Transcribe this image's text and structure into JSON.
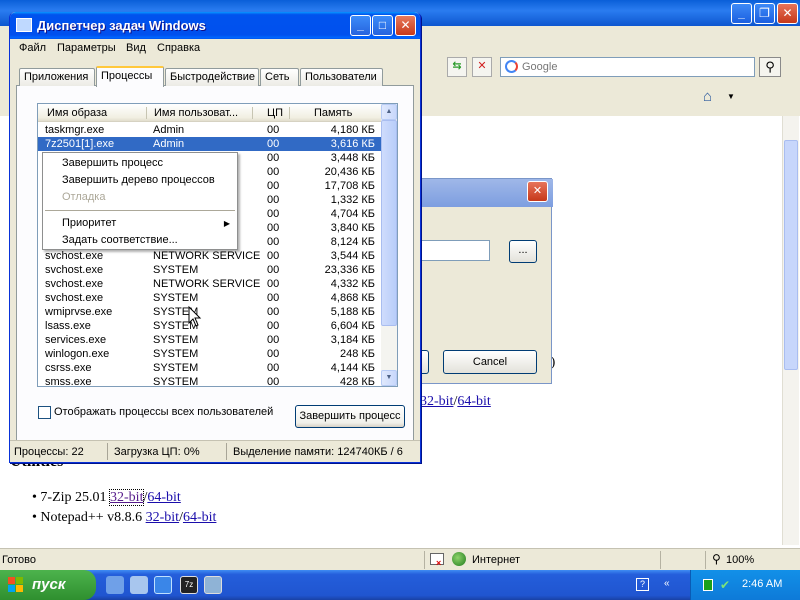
{
  "ie": {
    "google_placeholder": "Google",
    "status_text": "Готово",
    "zone": "Интернет",
    "zoom": "100%",
    "page": {
      "heading_fragment": "Utilities",
      "items": [
        {
          "name": "7-Zip 25.01",
          "link32": "32-bit",
          "link64": "64-bit"
        },
        {
          "name": "Notepad++ v8.8.6",
          "link32": "32-bit",
          "link64": "64-bit"
        }
      ],
      "behind_links": {
        "link32": "32-bit",
        "link64": "64-bit"
      },
      "paren": "r)"
    }
  },
  "dialog_behind": {
    "browse_label": "...",
    "cancel_label": "Cancel"
  },
  "taskmgr": {
    "title": "Диспетчер задач Windows",
    "menu": [
      "Файл",
      "Параметры",
      "Вид",
      "Справка"
    ],
    "tabs": [
      "Приложения",
      "Процессы",
      "Быстродействие",
      "Сеть",
      "Пользователи"
    ],
    "active_tab": 1,
    "columns": [
      "Имя образа",
      "Имя пользоват...",
      "ЦП",
      "Память"
    ],
    "rows": [
      {
        "image": "taskmgr.exe",
        "user": "Admin",
        "cpu": "00",
        "mem": "4,180 КБ"
      },
      {
        "image": "7z2501[1].exe",
        "user": "Admin",
        "cpu": "00",
        "mem": "3,616 КБ",
        "selected": true
      },
      {
        "image": "",
        "user": "",
        "cpu": "00",
        "mem": "3,448 КБ"
      },
      {
        "image": "",
        "user": "",
        "cpu": "00",
        "mem": "20,436 КБ"
      },
      {
        "image": "",
        "user": "",
        "cpu": "00",
        "mem": "17,708 КБ"
      },
      {
        "image": "",
        "user": "",
        "cpu": "00",
        "mem": "1,332 КБ"
      },
      {
        "image": "",
        "user": "",
        "cpu": "00",
        "mem": "4,704 КБ"
      },
      {
        "image": "",
        "user": "",
        "cpu": "00",
        "mem": "3,840 КБ"
      },
      {
        "image": "",
        "user": "",
        "cpu": "00",
        "mem": "8,124 КБ"
      },
      {
        "image": "svchost.exe",
        "user": "NETWORK SERVICE",
        "cpu": "00",
        "mem": "3,544 КБ"
      },
      {
        "image": "svchost.exe",
        "user": "SYSTEM",
        "cpu": "00",
        "mem": "23,336 КБ"
      },
      {
        "image": "svchost.exe",
        "user": "NETWORK SERVICE",
        "cpu": "00",
        "mem": "4,332 КБ"
      },
      {
        "image": "svchost.exe",
        "user": "SYSTEM",
        "cpu": "00",
        "mem": "4,868 КБ"
      },
      {
        "image": "wmiprvse.exe",
        "user": "SYSTEM",
        "cpu": "00",
        "mem": "5,188 КБ"
      },
      {
        "image": "lsass.exe",
        "user": "SYSTEM",
        "cpu": "00",
        "mem": "6,604 КБ"
      },
      {
        "image": "services.exe",
        "user": "SYSTEM",
        "cpu": "00",
        "mem": "3,184 КБ"
      },
      {
        "image": "winlogon.exe",
        "user": "SYSTEM",
        "cpu": "00",
        "mem": "248 КБ"
      },
      {
        "image": "csrss.exe",
        "user": "SYSTEM",
        "cpu": "00",
        "mem": "4,144 КБ"
      },
      {
        "image": "smss.exe",
        "user": "SYSTEM",
        "cpu": "00",
        "mem": "428 КБ"
      }
    ],
    "show_all_label": "Отображать процессы всех пользователей",
    "end_process_label": "Завершить процесс",
    "status": {
      "processes": "Процессы: 22",
      "cpu": "Загрузка ЦП: 0%",
      "commit": "Выделение памяти: 124740КБ / 6"
    },
    "context_menu": {
      "items": [
        {
          "label": "Завершить процесс",
          "enabled": true
        },
        {
          "label": "Завершить дерево процессов",
          "enabled": true
        },
        {
          "label": "Отладка",
          "enabled": false
        },
        {
          "label": "Приоритет",
          "enabled": true,
          "submenu": true
        },
        {
          "label": "Задать соответствие...",
          "enabled": true
        }
      ]
    }
  },
  "taskbar": {
    "start_label": "пуск",
    "clock": "2:46 AM"
  },
  "colors": {
    "xp_blue": "#0053ee",
    "selection": "#316ac5",
    "start_green": "#2f8f2f"
  }
}
